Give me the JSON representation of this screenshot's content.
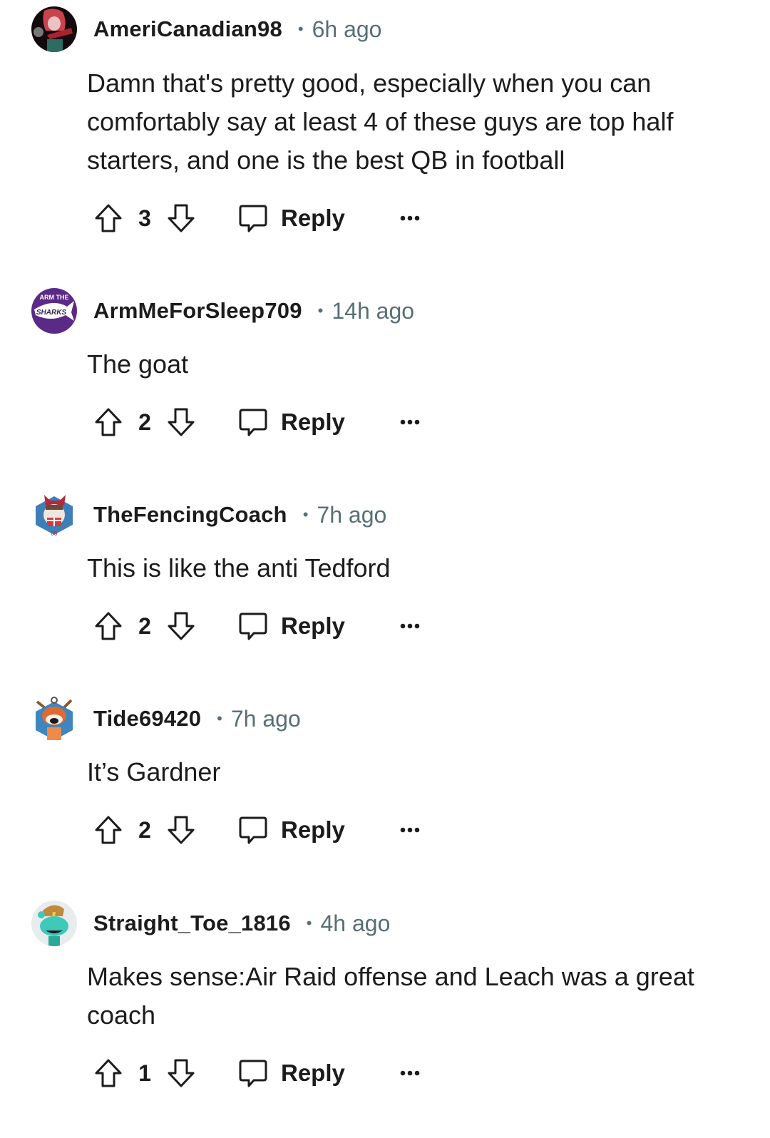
{
  "actions": {
    "reply_label": "Reply",
    "separator": "•"
  },
  "comments": [
    {
      "username": "AmeriCanadian98",
      "time": "6h ago",
      "avatar": "avatar-anime-character",
      "lines": [
        "Damn that's pretty good, especially when you can",
        "comfortably say at least 4 of these guys are top half",
        "starters, and one is the best QB in football"
      ],
      "score": "3"
    },
    {
      "username": "ArmMeForSleep709",
      "time": "14h ago",
      "avatar": "avatar-arm-the-sharks",
      "avatar_text": [
        "ARM THE",
        "SHARKS"
      ],
      "lines": [
        "The goat"
      ],
      "score": "2"
    },
    {
      "username": "TheFencingCoach",
      "time": "7h ago",
      "avatar": "avatar-snoo-helmet",
      "lines": [
        "This is like the anti Tedford"
      ],
      "score": "2"
    },
    {
      "username": "Tide69420",
      "time": "7h ago",
      "avatar": "avatar-snoo-orange",
      "lines": [
        "It’s Gardner"
      ],
      "score": "2"
    },
    {
      "username": "Straight_Toe_1816",
      "time": "4h ago",
      "avatar": "avatar-snoo-teal",
      "lines": [
        "Makes sense:Air Raid offense and Leach was a great",
        "coach"
      ],
      "score": "1"
    }
  ],
  "colors": {
    "text": "#1c1c1c",
    "meta": "#576f76",
    "background": "#ffffff"
  }
}
